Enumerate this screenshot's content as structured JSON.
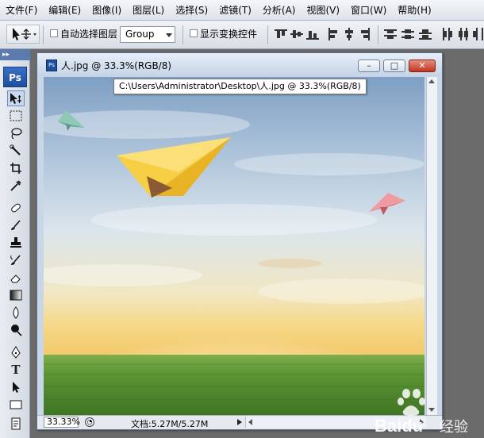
{
  "menu": [
    "文件(F)",
    "编辑(E)",
    "图像(I)",
    "图层(L)",
    "选择(S)",
    "滤镜(T)",
    "分析(A)",
    "视图(V)",
    "窗口(W)",
    "帮助(H)"
  ],
  "options": {
    "auto_select_label": "自动选择图层",
    "auto_select_value": "Group",
    "show_transform_label": "显示变换控件"
  },
  "toolbox": {
    "logo": "Ps",
    "grip": "▸▸",
    "tools": [
      "move-tool",
      "marquee-tool",
      "lasso-tool",
      "quick-selection-tool",
      "crop-tool",
      "eyedropper-tool",
      "healing-brush-tool",
      "brush-tool",
      "clone-stamp-tool",
      "history-brush-tool",
      "eraser-tool",
      "gradient-tool",
      "blur-tool",
      "dodge-tool",
      "pen-tool",
      "type-tool",
      "path-selection-tool",
      "shape-tool",
      "notes-tool"
    ]
  },
  "document": {
    "title": "人.jpg @ 33.3%(RGB/8)",
    "tooltip": "C:\\Users\\Administrator\\Desktop\\人.jpg @ 33.3%(RGB/8)",
    "icon_text": "Ps",
    "minimize": "–",
    "maximize": "□",
    "close": "✕",
    "zoom": "33.33%",
    "doc_size": "文档:5.27M/5.27M"
  },
  "watermark": {
    "brand": "Baidu",
    "suffix": "经验"
  },
  "colors": {
    "sky_top": "#7fa3c8",
    "sky_mid": "#d9e6ef",
    "horizon": "#f6d98c",
    "grass": "#5f9a3a",
    "plane_yellow": "#f2c230",
    "plane_pink": "#e07a84",
    "plane_teal": "#7fb9a8"
  }
}
